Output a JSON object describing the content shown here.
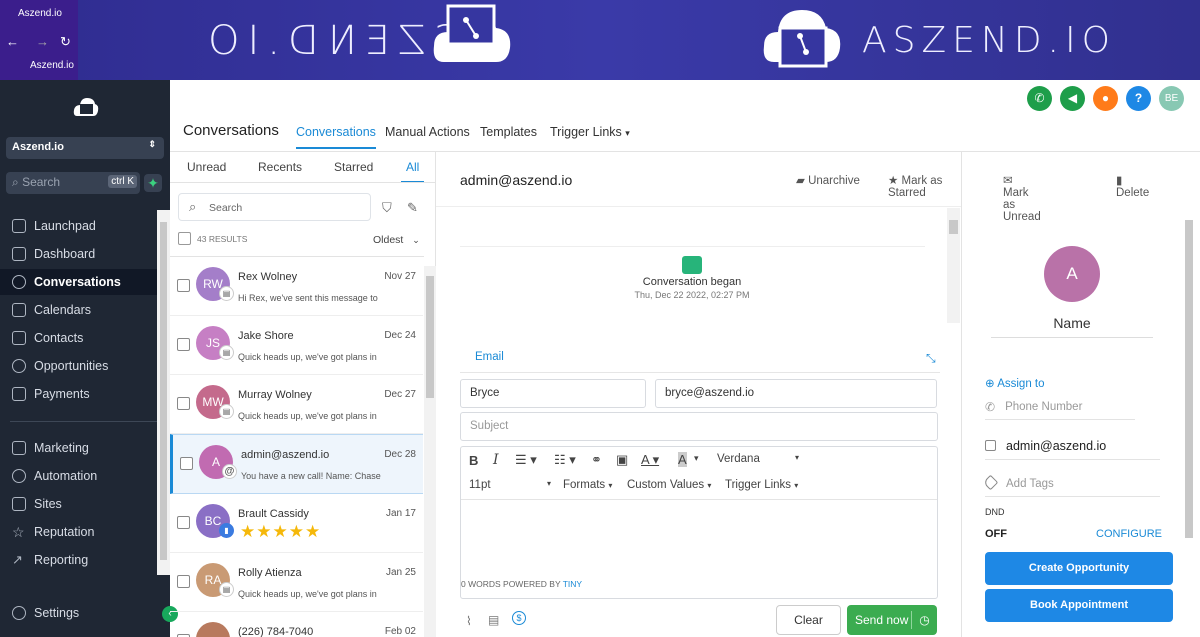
{
  "browser": {
    "tab_title": "Aszend.io",
    "tab_title2": "Aszend.io"
  },
  "banner": {
    "brand": "ASZEND.IO",
    "brand_mirrored": "ASZEND.IO"
  },
  "sidebar": {
    "location": "Aszend.io",
    "search_placeholder": "Search",
    "search_shortcut": "ctrl K",
    "items": [
      {
        "label": "Launchpad",
        "icon": "rocket-icon"
      },
      {
        "label": "Dashboard",
        "icon": "dashboard-icon"
      },
      {
        "label": "Conversations",
        "icon": "chat-icon",
        "active": true
      },
      {
        "label": "Calendars",
        "icon": "calendar-icon"
      },
      {
        "label": "Contacts",
        "icon": "contacts-icon"
      },
      {
        "label": "Opportunities",
        "icon": "opportunities-icon"
      },
      {
        "label": "Payments",
        "icon": "payments-icon"
      },
      {
        "label": "Marketing",
        "icon": "marketing-icon"
      },
      {
        "label": "Automation",
        "icon": "automation-icon"
      },
      {
        "label": "Sites",
        "icon": "sites-icon"
      },
      {
        "label": "Reputation",
        "icon": "star-icon"
      },
      {
        "label": "Reporting",
        "icon": "chart-icon"
      },
      {
        "label": "Settings",
        "icon": "gear-icon"
      }
    ]
  },
  "topbar": {
    "avatar_initials": "BE",
    "colors": {
      "phone": "#1e9e4a",
      "megaphone": "#1e9e4a",
      "bell": "#ff7b1a",
      "help": "#1e88e5",
      "avatar": "#88c8b3"
    }
  },
  "header": {
    "title": "Conversations",
    "tabs": [
      "Conversations",
      "Manual Actions",
      "Templates",
      "Trigger Links"
    ]
  },
  "list": {
    "filters": [
      "Unread",
      "Recents",
      "Starred",
      "All"
    ],
    "search_placeholder": "Search",
    "results": "43 RESULTS",
    "sort": "Oldest",
    "conversations": [
      {
        "initials": "RW",
        "name": "Rex Wolney",
        "date": "Nov 27",
        "preview": "Hi Rex, we've sent this message to",
        "color": "#a47ec9"
      },
      {
        "initials": "JS",
        "name": "Jake Shore",
        "date": "Dec 24",
        "preview": "Quick heads up, we've got plans in",
        "color": "#c67fc4"
      },
      {
        "initials": "MW",
        "name": "Murray Wolney",
        "date": "Dec 27",
        "preview": "Quick heads up, we've got plans in",
        "color": "#c46a8c"
      },
      {
        "initials": "A",
        "name": "admin@aszend.io",
        "date": "Dec 28",
        "preview": "You have a new call! Name: Chase",
        "color": "#c16bb1"
      },
      {
        "initials": "BC",
        "name": "Brault Cassidy",
        "date": "Jan 17",
        "preview": "",
        "color": "#8a6fc5",
        "stars": "★★★★★",
        "rating": 5
      },
      {
        "initials": "RA",
        "name": "Rolly Atienza",
        "date": "Jan 25",
        "preview": "Quick heads up, we've got plans in",
        "color": "#c99a74"
      },
      {
        "initials": "",
        "name": "(226) 784-7040",
        "date": "Feb 02",
        "preview": "",
        "color": "#b87a5e"
      }
    ]
  },
  "conversation": {
    "title": "admin@aszend.io",
    "actions": [
      "Unarchive",
      "Mark as Starred",
      "Mark as Unread",
      "Delete"
    ],
    "event": "Conversation began",
    "event_date": "Thu, Dec 22 2022, 02:27 PM",
    "compose": {
      "channel": "Email",
      "from_name": "Bryce",
      "from_email": "bryce@aszend.io",
      "subject_placeholder": "Subject",
      "font": "Verdana",
      "size": "11pt",
      "menus": [
        "Formats",
        "Custom Values",
        "Trigger Links"
      ],
      "footer_words": "0 WORDS POWERED BY",
      "footer_brand": "TINY",
      "clear": "Clear",
      "send": "Send now"
    }
  },
  "contact": {
    "initial": "A",
    "name": "Name",
    "assign": "Assign to",
    "phone_placeholder": "Phone Number",
    "email": "admin@aszend.io",
    "tags_placeholder": "Add Tags",
    "dnd_label": "DND",
    "dnd_value": "OFF",
    "configure": "CONFIGURE",
    "create_opportunity": "Create Opportunity",
    "book_appointment": "Book Appointment"
  }
}
